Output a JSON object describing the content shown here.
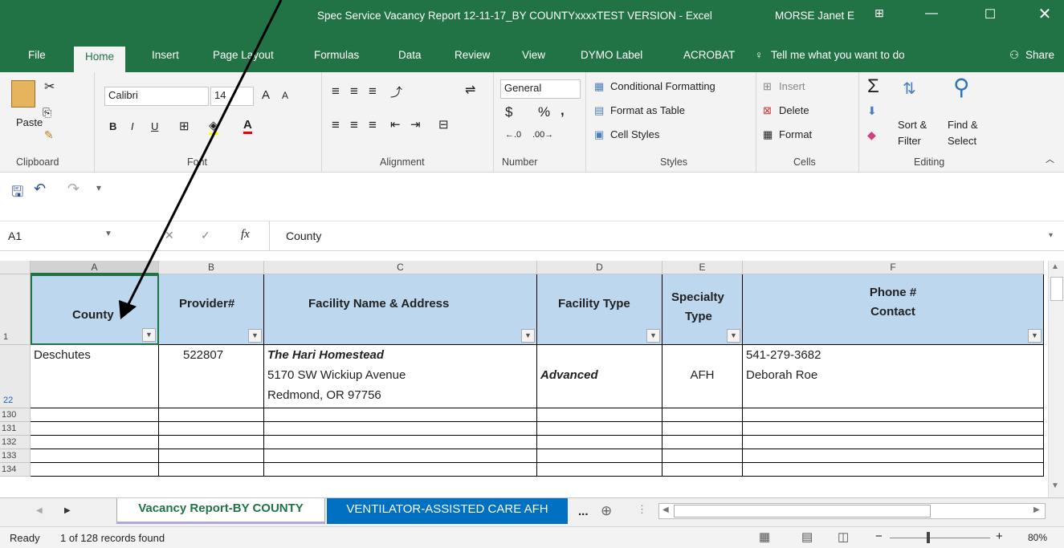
{
  "window": {
    "title": "Spec Service Vacancy Report 12-11-17_BY COUNTYxxxxTEST VERSION  -  Excel",
    "user": "MORSE Janet E"
  },
  "tabs": [
    "File",
    "Home",
    "Insert",
    "Page Layout",
    "Formulas",
    "Data",
    "Review",
    "View",
    "DYMO Label",
    "ACROBAT"
  ],
  "tell_me": "Tell me what you want to do",
  "share": "Share",
  "ribbon": {
    "clipboard": {
      "paste": "Paste",
      "label": "Clipboard"
    },
    "font": {
      "name": "Calibri",
      "size": "14",
      "label": "Font",
      "bold": "B",
      "italic": "I",
      "underline": "U",
      "grow": "A",
      "shrink": "A"
    },
    "alignment": {
      "label": "Alignment"
    },
    "number": {
      "format": "General",
      "currency": "$",
      "percent": "%",
      "comma": ",",
      "label": "Number"
    },
    "styles": {
      "conditional": "Conditional Formatting",
      "table": "Format as Table",
      "cell_styles": "Cell Styles",
      "label": "Styles"
    },
    "cells": {
      "insert": "Insert",
      "delete": "Delete",
      "format": "Format",
      "label": "Cells"
    },
    "editing": {
      "sort": "Sort &",
      "sort2": "Filter",
      "find": "Find &",
      "find2": "Select",
      "label": "Editing"
    }
  },
  "formula_bar": {
    "name_box": "A1",
    "fx": "fx",
    "content": "County"
  },
  "columns": [
    "A",
    "B",
    "C",
    "D",
    "E",
    "F"
  ],
  "headers": {
    "county": "County",
    "provider": "Provider#",
    "facility": "Facility Name & Address",
    "type": "Facility Type",
    "specialty1": "Specialty",
    "specialty2": "Type",
    "phone1": "Phone #",
    "phone2": "Contact"
  },
  "row_numbers": [
    "1",
    "22",
    "130",
    "131",
    "132",
    "133",
    "134"
  ],
  "record": {
    "county": "Deschutes",
    "provider": "522807",
    "name": "The Hari Homestead",
    "address1": "5170 SW Wickiup Avenue",
    "address2": "Redmond, OR 97756",
    "type": "Advanced",
    "specialty": "AFH",
    "phone": "541-279-3682",
    "contact": "Deborah Roe"
  },
  "sheet_tabs": [
    "Vacancy Report-BY COUNTY",
    "VENTILATOR-ASSISTED CARE AFH"
  ],
  "more": "...",
  "status": {
    "ready": "Ready",
    "records": "1 of 128 records found",
    "zoom": "80%"
  },
  "colors": {
    "excel_green": "#217346",
    "header_fill": "#bdd7ee",
    "tab_active": "#b4a7d6",
    "tab_blue": "#0070c0"
  }
}
